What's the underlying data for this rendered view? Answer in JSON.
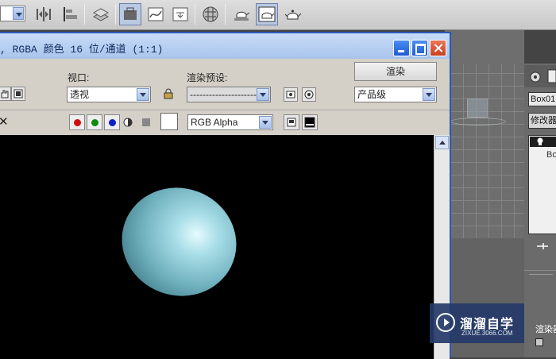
{
  "render_window": {
    "title": ", RGBA 颜色 16 位/通道 (1:1)",
    "viewport_label": "视口:",
    "viewport_value": "透视",
    "preset_label": "渲染预设:",
    "preset_value": "----------------------",
    "render_button": "渲染",
    "quality_value": "产品级",
    "channel_value": "RGB Alpha",
    "close_glyph": "✕"
  },
  "command_panel": {
    "object_name": "Box01",
    "modifier_list": "修改器",
    "stack_item": "Bo",
    "rollout_label": "渲染器"
  },
  "watermark": {
    "title": "溜溜自学",
    "url": "ZIXUE.3066.COM"
  },
  "colors": {
    "title_bar": "#a9c4ec",
    "window_bg": "#d4d0c8",
    "canvas_bg": "#000000",
    "red": "#cc1010",
    "green": "#108a10",
    "blue": "#1020c8"
  }
}
